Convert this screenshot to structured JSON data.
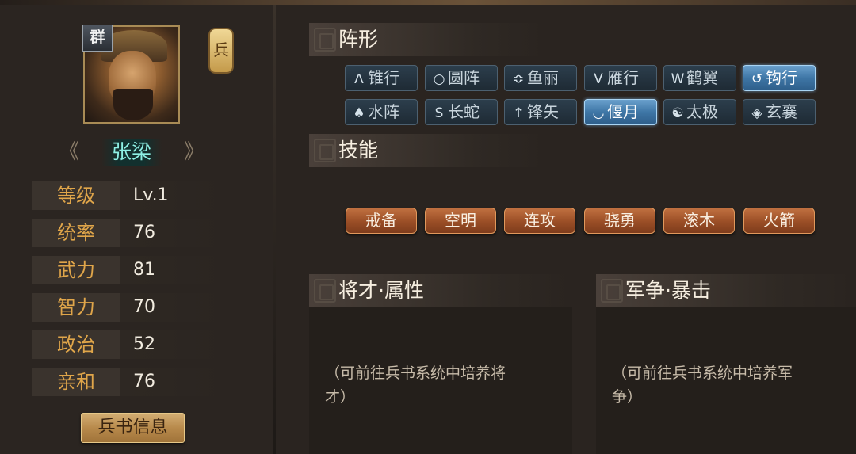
{
  "hero": {
    "faction_badge": "群",
    "troop_badge": "兵",
    "name": "张梁",
    "prev_arrow": "《",
    "next_arrow": "》",
    "stats": [
      {
        "label": "等级",
        "value": "Lv.1"
      },
      {
        "label": "统率",
        "value": "76"
      },
      {
        "label": "武力",
        "value": "81"
      },
      {
        "label": "智力",
        "value": "70"
      },
      {
        "label": "政治",
        "value": "52"
      },
      {
        "label": "亲和",
        "value": "76"
      }
    ],
    "book_button": "兵书信息"
  },
  "formation": {
    "title": "阵形",
    "items": [
      {
        "icon": "arrow-up-icon",
        "glyph": "ᐱ",
        "label": "锥行",
        "active": false
      },
      {
        "icon": "circle-icon",
        "glyph": "○",
        "label": "圆阵",
        "active": false
      },
      {
        "icon": "fish-scale-icon",
        "glyph": "≎",
        "label": "鱼丽",
        "active": false
      },
      {
        "icon": "v-shape-icon",
        "glyph": "V",
        "label": "雁行",
        "active": false
      },
      {
        "icon": "w-shape-icon",
        "glyph": "W",
        "label": "鹤翼",
        "active": false
      },
      {
        "icon": "hook-icon",
        "glyph": "↺",
        "label": "钩行",
        "active": true
      },
      {
        "icon": "water-icon",
        "glyph": "♠",
        "label": "水阵",
        "active": false
      },
      {
        "icon": "snake-icon",
        "glyph": "S",
        "label": "长蛇",
        "active": false
      },
      {
        "icon": "arrowhead-icon",
        "glyph": "↑",
        "label": "锋矢",
        "active": false
      },
      {
        "icon": "crescent-icon",
        "glyph": "◡",
        "label": "偃月",
        "active": true
      },
      {
        "icon": "taiji-icon",
        "glyph": "☯",
        "label": "太极",
        "active": false
      },
      {
        "icon": "diamond-icon",
        "glyph": "◈",
        "label": "玄襄",
        "active": false
      }
    ]
  },
  "skills": {
    "title": "技能",
    "items": [
      "戒备",
      "空明",
      "连攻",
      "骁勇",
      "滚木",
      "火箭"
    ]
  },
  "talent": {
    "title": "将才·属性",
    "hint_line1": "（可前往兵书系统中培养将",
    "hint_line2": "才）"
  },
  "warfare": {
    "title": "军争·暴击",
    "hint_line1": "（可前往兵书系统中培养军",
    "hint_line2": "争）"
  },
  "colors": {
    "stat_label": "#e0a64a",
    "name": "#8ef0e4",
    "active_formation": "#4a86b8",
    "skill": "#9a4e26"
  }
}
